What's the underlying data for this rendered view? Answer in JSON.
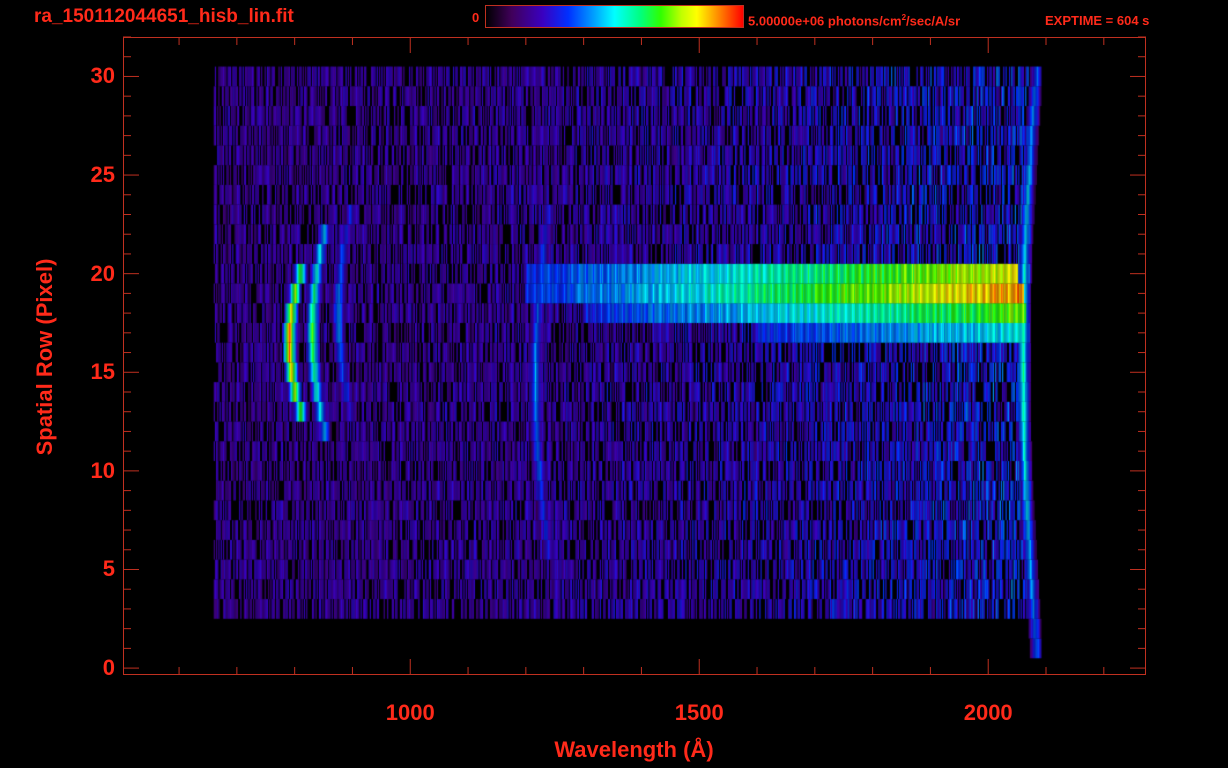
{
  "header": {
    "filename": "ra_150112044651_hisb_lin.fit",
    "colorbar_min": "0",
    "colorbar_max": "5.00000e+06 photons/cm",
    "colorbar_max_sup": "2",
    "colorbar_max_unit": "/sec/A/sr",
    "exptime": "EXPTIME = 604 s"
  },
  "colors": {
    "axis": "#ff2a1a",
    "frame": "#c03020",
    "background": "#000000"
  },
  "chart_data": {
    "type": "heatmap",
    "title": "ra_150112044651_hisb_lin.fit",
    "xlabel": "Wavelength (Å)",
    "ylabel": "Spatial Row (Pixel)",
    "xlim": [
      503,
      2273
    ],
    "ylim": [
      -0.35,
      32
    ],
    "xticks": [
      {
        "value": 1000,
        "label": "1000"
      },
      {
        "value": 1500,
        "label": "1500"
      },
      {
        "value": 2000,
        "label": "2000"
      }
    ],
    "xminor_step": 100,
    "yticks": [
      {
        "value": 0,
        "label": "0"
      },
      {
        "value": 5,
        "label": "5"
      },
      {
        "value": 10,
        "label": "10"
      },
      {
        "value": 15,
        "label": "15"
      },
      {
        "value": 20,
        "label": "20"
      },
      {
        "value": 25,
        "label": "25"
      },
      {
        "value": 30,
        "label": "30"
      }
    ],
    "yminor_step": 1,
    "colorscale": {
      "min": 0,
      "max": 5000000,
      "units": "photons/cm^2/sec/A/sr",
      "map": "rainbow"
    },
    "background_noise": {
      "wavelength_range": [
        660,
        2070
      ],
      "rows": [
        3,
        30
      ]
    },
    "features": [
      {
        "name": "Lyman-alpha line",
        "wavelength": 1216,
        "rows": [
          6,
          23
        ],
        "intensity": 0.45
      },
      {
        "name": "continuum row 20",
        "wavelength_range": [
          1200,
          2050
        ],
        "row": 20,
        "intensity_range": [
          0.3,
          0.8
        ]
      },
      {
        "name": "continuum row 19",
        "wavelength_range": [
          1200,
          2060
        ],
        "row": 19,
        "intensity_range": [
          0.3,
          0.9
        ]
      },
      {
        "name": "continuum row 18",
        "wavelength_range": [
          1300,
          2065
        ],
        "row": 18,
        "intensity_range": [
          0.3,
          0.7
        ]
      },
      {
        "name": "continuum row 17",
        "wavelength_range": [
          1600,
          2060
        ],
        "row": 17,
        "intensity_range": [
          0.3,
          0.5
        ]
      },
      {
        "name": "emission arc core",
        "wavelength": 790,
        "rows": [
          13,
          20
        ],
        "intensity": 1.0
      },
      {
        "name": "emission arc echo 1",
        "wavelength": 830,
        "rows": [
          12,
          22
        ],
        "intensity": 0.7
      },
      {
        "name": "emission arc echo 2",
        "wavelength": 875,
        "rows": [
          13,
          23
        ],
        "intensity": 0.45
      },
      {
        "name": "detector edge",
        "wavelength": 2060,
        "rows": [
          1,
          30
        ],
        "intensity": 0.6
      }
    ]
  }
}
